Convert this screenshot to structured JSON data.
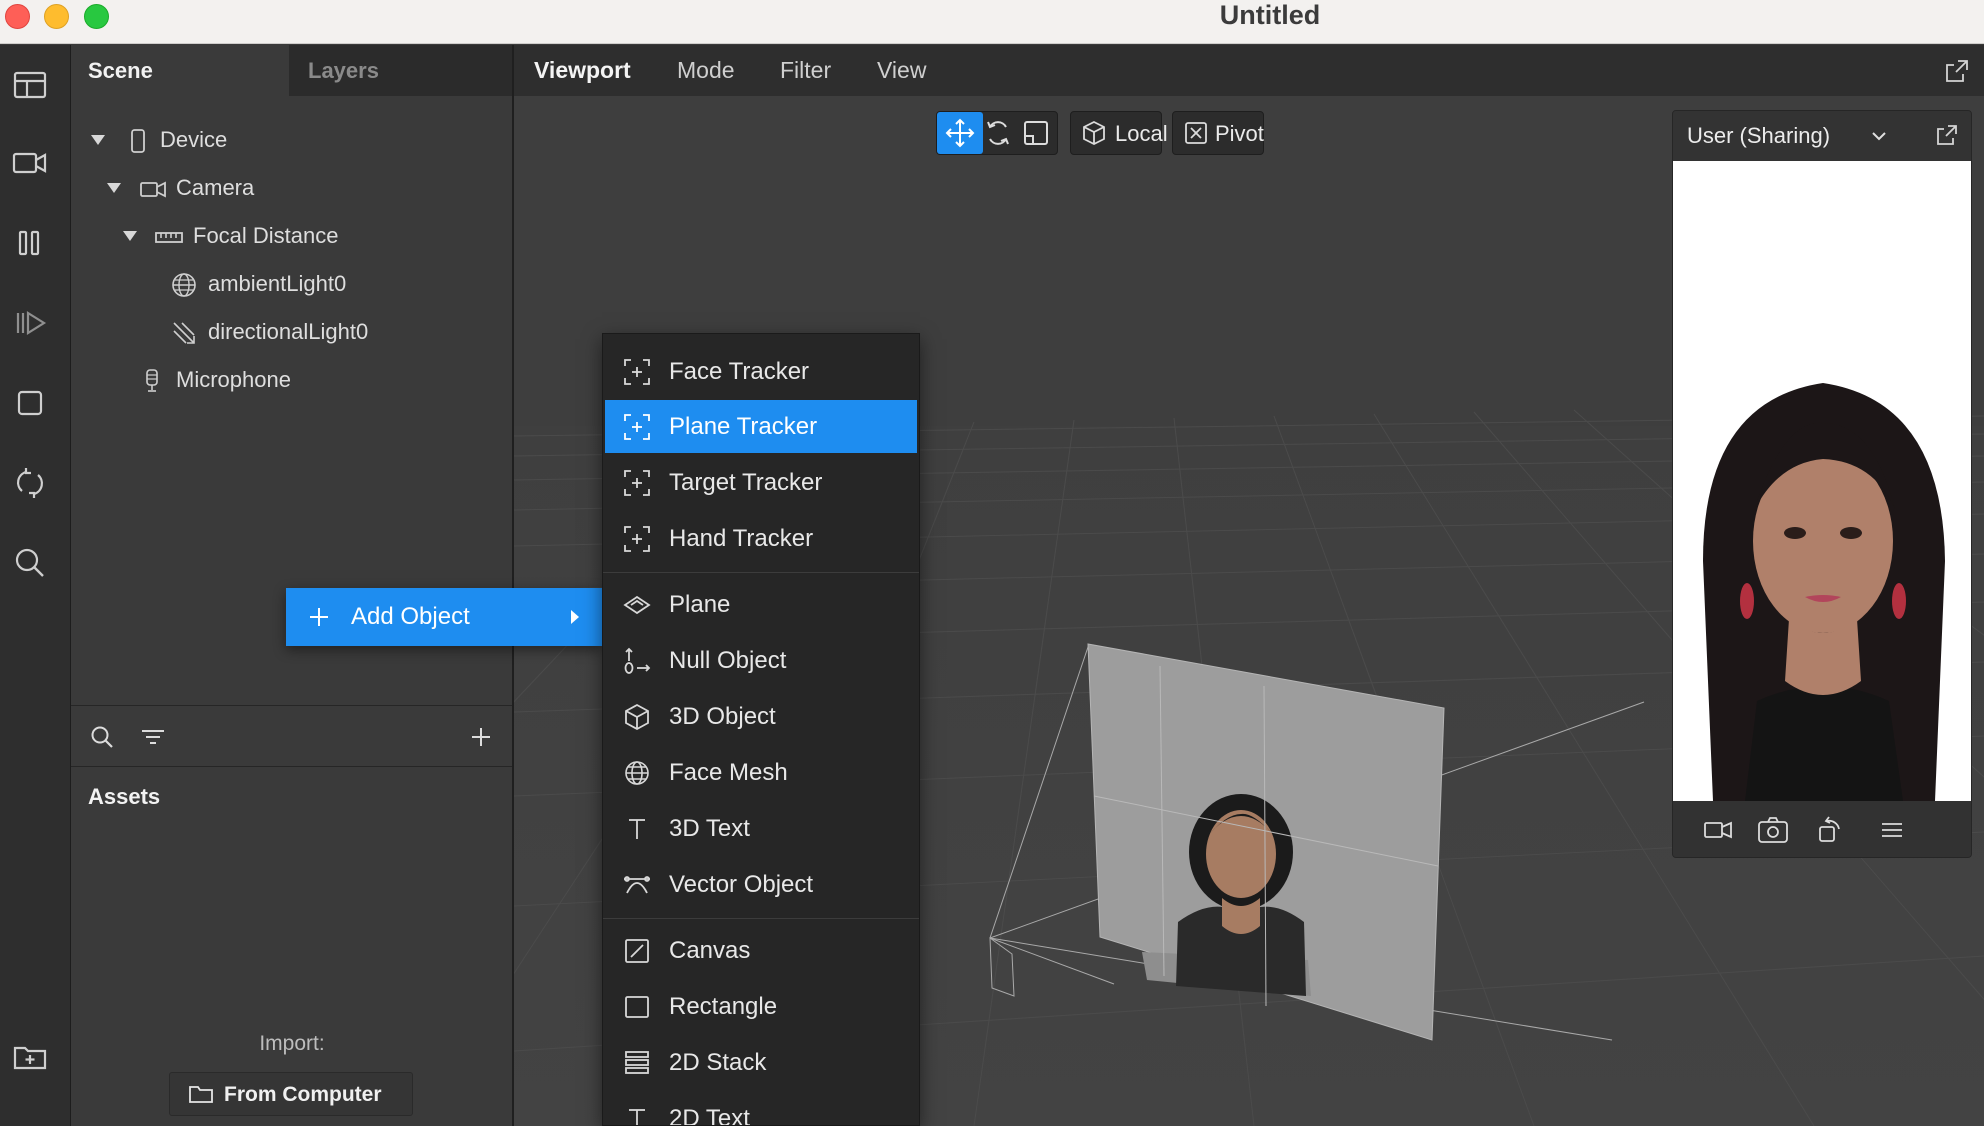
{
  "window": {
    "title": "Untitled"
  },
  "scene_panel": {
    "tabs": [
      "Scene",
      "Layers"
    ],
    "tree": [
      {
        "label": "Device",
        "icon": "phone-icon"
      },
      {
        "label": "Camera",
        "icon": "camera-icon"
      },
      {
        "label": "Focal Distance",
        "icon": "ruler-icon"
      },
      {
        "label": "ambientLight0",
        "icon": "globe-icon"
      },
      {
        "label": "directionalLight0",
        "icon": "directional-light-icon"
      },
      {
        "label": "Microphone",
        "icon": "microphone-icon"
      }
    ]
  },
  "assets": {
    "title": "Assets",
    "import_label": "Import:",
    "from_computer": "From Computer"
  },
  "viewport": {
    "menu": [
      "Viewport",
      "Mode",
      "Filter",
      "View"
    ],
    "tools": {
      "local": "Local",
      "pivot": "Pivot"
    }
  },
  "preview": {
    "title": "User (Sharing)"
  },
  "context_menu": {
    "add_object": "Add Object",
    "submenu": [
      {
        "label": "Face Tracker",
        "icon": "tracker-icon"
      },
      {
        "label": "Plane Tracker",
        "icon": "tracker-icon",
        "selected": true
      },
      {
        "label": "Target Tracker",
        "icon": "tracker-icon"
      },
      {
        "label": "Hand Tracker",
        "icon": "tracker-icon"
      },
      {
        "label": "Plane",
        "icon": "plane-icon"
      },
      {
        "label": "Null Object",
        "icon": "null-object-icon"
      },
      {
        "label": "3D Object",
        "icon": "cube-icon"
      },
      {
        "label": "Face Mesh",
        "icon": "face-mesh-icon"
      },
      {
        "label": "3D Text",
        "icon": "text-icon"
      },
      {
        "label": "Vector Object",
        "icon": "vector-icon"
      },
      {
        "label": "Canvas",
        "icon": "canvas-icon"
      },
      {
        "label": "Rectangle",
        "icon": "rectangle-icon"
      },
      {
        "label": "2D Stack",
        "icon": "stack-icon"
      },
      {
        "label": "2D Text",
        "icon": "text-icon"
      }
    ]
  },
  "colors": {
    "accent": "#1e8df0",
    "panel": "#3a3a3a",
    "dark": "#262626"
  }
}
